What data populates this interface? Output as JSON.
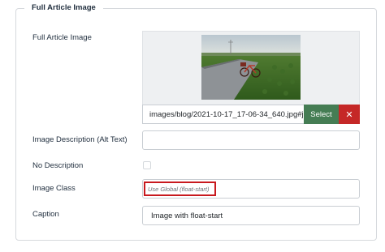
{
  "fieldset": {
    "legend": "Full Article Image"
  },
  "fields": {
    "image_label": "Full Article Image",
    "image_path": "images/blog/2021-10-17_17-06-34_640.jpg#j",
    "select_label": "Select",
    "clear_label": "✕",
    "description_label": "Image Description (Alt Text)",
    "description_value": "",
    "no_description_label": "No Description",
    "image_class_label": "Image Class",
    "image_class_value": "Use Global (float-start)",
    "caption_label": "Caption",
    "caption_value": "Image with float-start"
  },
  "colors": {
    "select_button": "#457d54",
    "clear_button": "#c52827",
    "highlight": "#c8191e"
  }
}
